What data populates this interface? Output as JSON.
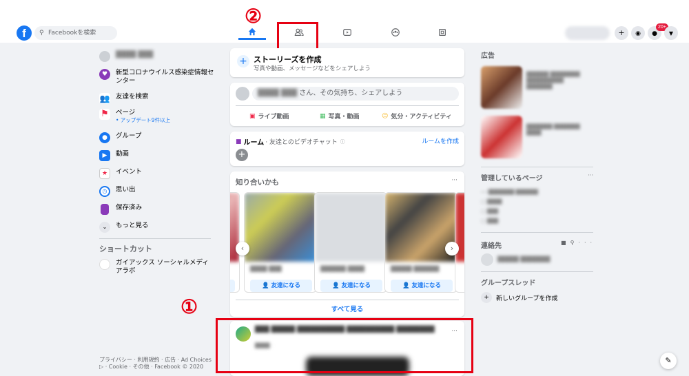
{
  "search": {
    "placeholder": "Facebookを検索"
  },
  "header": {
    "notifications_badge": "20+"
  },
  "annotations": {
    "one": "①",
    "two": "②"
  },
  "left_sidebar": {
    "items": [
      {
        "label": "新型コロナウイルス感染症情報センター",
        "icon": "covid-info-icon"
      },
      {
        "label": "友達を検索",
        "icon": "friends-icon"
      },
      {
        "label": "ページ",
        "sub": "• アップデート9件以上",
        "icon": "flag-icon"
      },
      {
        "label": "グループ",
        "icon": "groups-icon"
      },
      {
        "label": "動画",
        "icon": "video-icon"
      },
      {
        "label": "イベント",
        "icon": "event-icon"
      },
      {
        "label": "思い出",
        "icon": "memories-icon"
      },
      {
        "label": "保存済み",
        "icon": "saved-icon"
      },
      {
        "label": "もっと見る",
        "icon": "chevron-down-icon"
      }
    ],
    "shortcuts_title": "ショートカット",
    "shortcut_item": "ガイアックス ソーシャルメディアラボ",
    "footer_line1": "プライバシー · 利用規約 · 広告 · Ad Choices",
    "footer_line2": "▷ · Cookie · その他 · Facebook © 2020"
  },
  "stories": {
    "title": "ストーリーズを作成",
    "subtitle": "写真や動画、メッセージなどをシェアしよう"
  },
  "composer": {
    "prompt": "さん、その気持ち、シェアしよう",
    "live": "ライブ動画",
    "photo": "写真・動画",
    "feeling": "気分・アクティビティ"
  },
  "rooms": {
    "title": "ルーム",
    "subtitle": "· 友達とのビデオチャット",
    "create": "ルームを作成"
  },
  "pymk": {
    "title": "知り合いかも",
    "add_friend": "友達になる",
    "see_all": "すべて見る",
    "more": "···"
  },
  "post": {
    "more": "···"
  },
  "right_sidebar": {
    "ads_title": "広告",
    "managed_pages_title": "管理しているページ",
    "contacts_title": "連絡先",
    "group_threads_title": "グループスレッド",
    "new_group": "新しいグループを作成",
    "more": "···"
  },
  "colors": {
    "accent": "#1877f2",
    "annotation": "#e60012",
    "background": "#f0f2f5"
  }
}
